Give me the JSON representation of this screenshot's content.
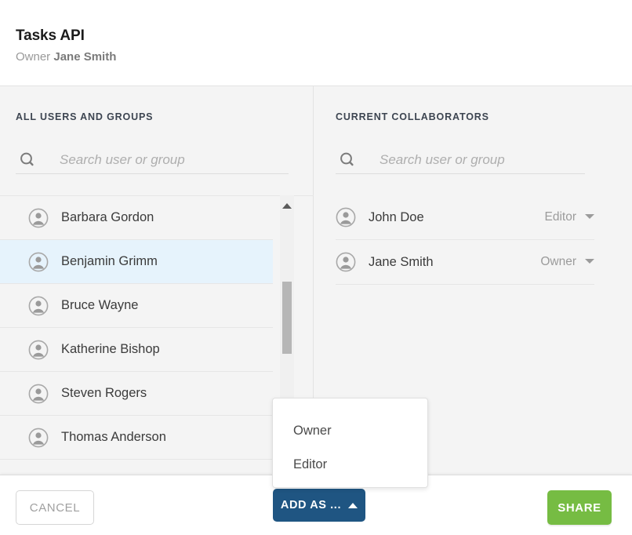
{
  "header": {
    "title": "Tasks API",
    "owner_label": "Owner",
    "owner_name": "Jane Smith"
  },
  "left_panel": {
    "heading": "ALL USERS AND GROUPS",
    "search": {
      "icon": "search-icon",
      "placeholder": "Search user or group",
      "value": ""
    },
    "users": [
      {
        "name": "Barbara Gordon",
        "selected": false
      },
      {
        "name": "Benjamin Grimm",
        "selected": true
      },
      {
        "name": "Bruce Wayne",
        "selected": false
      },
      {
        "name": "Katherine Bishop",
        "selected": false
      },
      {
        "name": "Steven Rogers",
        "selected": false
      },
      {
        "name": "Thomas Anderson",
        "selected": false
      }
    ],
    "scrollbar": {
      "up_arrow_icon": "triangle-up-icon"
    }
  },
  "right_panel": {
    "heading": "CURRENT COLLABORATORS",
    "search": {
      "icon": "search-icon",
      "placeholder": "Search user or group",
      "value": ""
    },
    "collaborators": [
      {
        "name": "John Doe",
        "role": "Editor"
      },
      {
        "name": "Jane Smith",
        "role": "Owner"
      }
    ]
  },
  "role_dropdown": {
    "open": true,
    "options": [
      "Owner",
      "Editor"
    ]
  },
  "footer": {
    "cancel_label": "CANCEL",
    "add_as_label": "ADD AS ...",
    "share_label": "SHARE"
  },
  "colors": {
    "accent_blue": "#1f5582",
    "share_green": "#76bc43",
    "selected_row": "#e6f3fc",
    "body_bg": "#f4f4f4"
  }
}
